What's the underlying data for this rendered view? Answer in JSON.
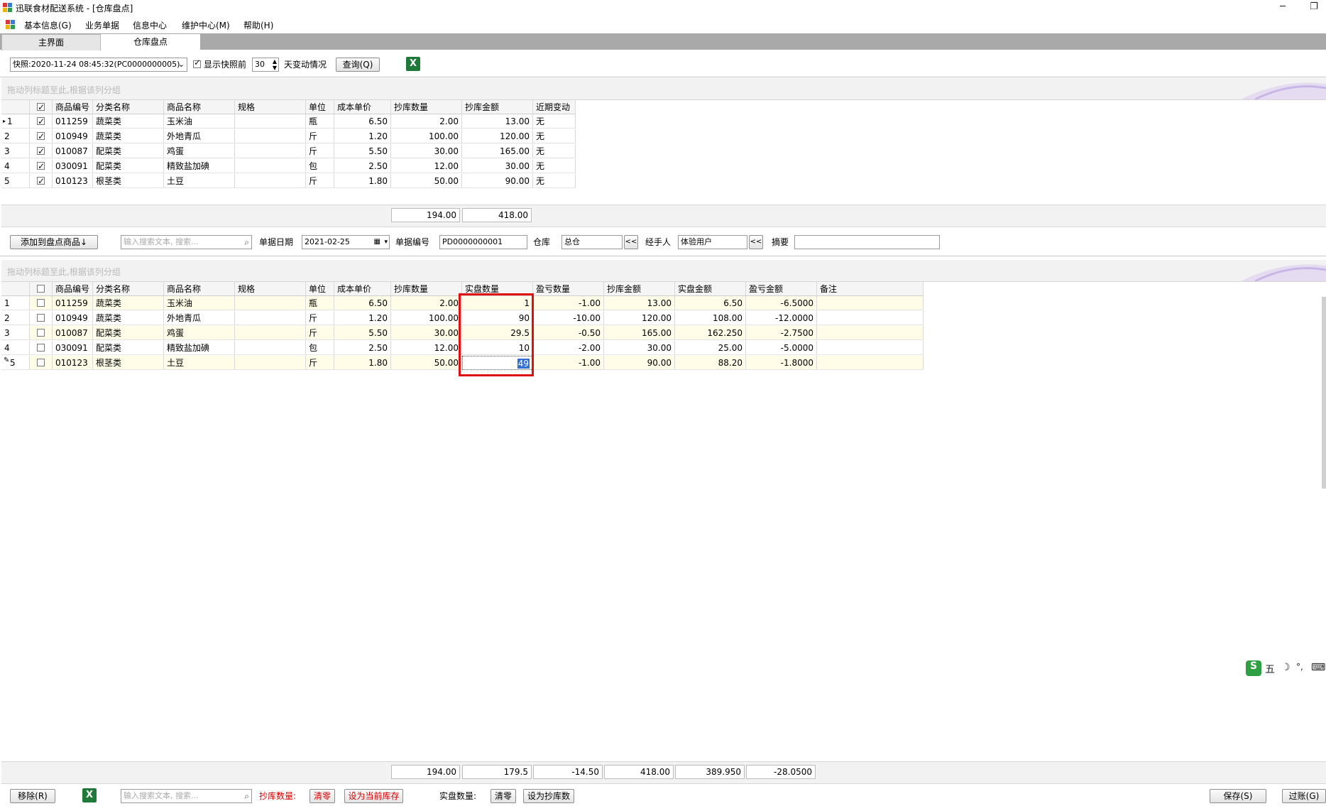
{
  "window": {
    "title": "迅联食材配送系统 - [仓库盘点]",
    "minimize": "─",
    "restore": "❐"
  },
  "menu": [
    "基本信息(G)",
    "业务单据",
    "信息中心",
    "维护中心(M)",
    "帮助(H)"
  ],
  "tabs": [
    {
      "label": "主界面",
      "active": false
    },
    {
      "label": "仓库盘点",
      "active": true
    }
  ],
  "toolbar1": {
    "snapshot": "快照:2020-11-24 08:45:32(PC0000000005)",
    "show_before_label": "显示快照前",
    "days_value": "30",
    "days_suffix": "天变动情况",
    "query_button": "查询(Q)"
  },
  "group_hint": "拖动列标题至此,根据该列分组",
  "top_grid": {
    "columns": [
      "商品编号",
      "分类名称",
      "商品名称",
      "规格",
      "单位",
      "成本单价",
      "抄库数量",
      "抄库金额",
      "近期变动"
    ],
    "rows": [
      {
        "no": "1",
        "code": "011259",
        "cat": "蔬菜类",
        "name": "玉米油",
        "spec": "",
        "unit": "瓶",
        "price": "6.50",
        "qty": "2.00",
        "amount": "13.00",
        "change": "无"
      },
      {
        "no": "2",
        "code": "010949",
        "cat": "蔬菜类",
        "name": "外地青瓜",
        "spec": "",
        "unit": "斤",
        "price": "1.20",
        "qty": "100.00",
        "amount": "120.00",
        "change": "无"
      },
      {
        "no": "3",
        "code": "010087",
        "cat": "配菜类",
        "name": "鸡蛋",
        "spec": "",
        "unit": "斤",
        "price": "5.50",
        "qty": "30.00",
        "amount": "165.00",
        "change": "无"
      },
      {
        "no": "4",
        "code": "030091",
        "cat": "配菜类",
        "name": "精致盐加碘",
        "spec": "",
        "unit": "包",
        "price": "2.50",
        "qty": "12.00",
        "amount": "30.00",
        "change": "无"
      },
      {
        "no": "5",
        "code": "010123",
        "cat": "根茎类",
        "name": "土豆",
        "spec": "",
        "unit": "斤",
        "price": "1.80",
        "qty": "50.00",
        "amount": "90.00",
        "change": "无"
      }
    ],
    "sum_qty": "194.00",
    "sum_amount": "418.00"
  },
  "toolbar2": {
    "add_button": "添加到盘点商品↓",
    "search_placeholder": "输入搜索文本, 搜索...",
    "date_label": "单据日期",
    "date_value": "2021-02-25",
    "no_label": "单据编号",
    "no_value": "PD0000000001",
    "warehouse_label": "仓库",
    "warehouse_value": "总仓",
    "handler_label": "经手人",
    "handler_value": "体验用户",
    "remark_label": "摘要",
    "remark_value": "",
    "back_symbol": "<<"
  },
  "bottom_grid": {
    "columns": [
      "商品编号",
      "分类名称",
      "商品名称",
      "规格",
      "单位",
      "成本单价",
      "抄库数量",
      "实盘数量",
      "盈亏数量",
      "抄库金额",
      "实盘金额",
      "盈亏金额",
      "备注"
    ],
    "rows": [
      {
        "no": "1",
        "code": "011259",
        "cat": "蔬菜类",
        "name": "玉米油",
        "spec": "",
        "unit": "瓶",
        "price": "6.50",
        "qty": "2.00",
        "actual": "1",
        "diff": "-1.00",
        "amount": "13.00",
        "actual_amount": "6.50",
        "diff_amount": "-6.5000",
        "remark": ""
      },
      {
        "no": "2",
        "code": "010949",
        "cat": "蔬菜类",
        "name": "外地青瓜",
        "spec": "",
        "unit": "斤",
        "price": "1.20",
        "qty": "100.00",
        "actual": "90",
        "diff": "-10.00",
        "amount": "120.00",
        "actual_amount": "108.00",
        "diff_amount": "-12.0000",
        "remark": ""
      },
      {
        "no": "3",
        "code": "010087",
        "cat": "配菜类",
        "name": "鸡蛋",
        "spec": "",
        "unit": "斤",
        "price": "5.50",
        "qty": "30.00",
        "actual": "29.5",
        "diff": "-0.50",
        "amount": "165.00",
        "actual_amount": "162.250",
        "diff_amount": "-2.7500",
        "remark": ""
      },
      {
        "no": "4",
        "code": "030091",
        "cat": "配菜类",
        "name": "精致盐加碘",
        "spec": "",
        "unit": "包",
        "price": "2.50",
        "qty": "12.00",
        "actual": "10",
        "diff": "-2.00",
        "amount": "30.00",
        "actual_amount": "25.00",
        "diff_amount": "-5.0000",
        "remark": ""
      },
      {
        "no": "5",
        "code": "010123",
        "cat": "根茎类",
        "name": "土豆",
        "spec": "",
        "unit": "斤",
        "price": "1.80",
        "qty": "50.00",
        "actual": "49",
        "diff": "-1.00",
        "amount": "90.00",
        "actual_amount": "88.20",
        "diff_amount": "-1.8000",
        "remark": ""
      }
    ],
    "sums": [
      "194.00",
      "179.5",
      "-14.50",
      "418.00",
      "389.950",
      "-28.0500"
    ]
  },
  "footer": {
    "remove_button": "移除(R)",
    "search_placeholder": "输入搜索文本, 搜索...",
    "qty_label": "抄库数量:",
    "clear_button": "清零",
    "set_current_button": "设为当前库存",
    "actual_label": "实盘数量:",
    "clear2_button": "清零",
    "set_qty_button": "设为抄库数",
    "save_button": "保存(S)",
    "post_button": "过账(G)"
  },
  "ime": {
    "s": "S",
    "wu": "五",
    "moon": "☽",
    "dot": "°,",
    "kbd": "⌨"
  }
}
